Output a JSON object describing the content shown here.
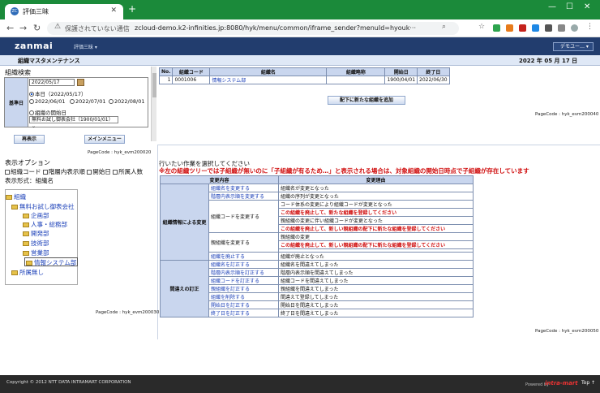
{
  "browser": {
    "tab_title": "評価三昧",
    "favicon_text": "ZC",
    "url_warning": "保護されていない通信",
    "url": "zcloud-demo.k2-infinities.jp:8080/hyk/menu/common/iframe_sender?menuId=hyouk···"
  },
  "app": {
    "logo": "zanmai",
    "menu_label": "評価三昧 ▾",
    "user_menu": "デモユー… ▾"
  },
  "page": {
    "title": "組織マスタメンテナンス",
    "date": "2022 年 05 月 17 日"
  },
  "search": {
    "title": "組織検索",
    "base_date_label": "基準日",
    "date_value": "2022/05/17",
    "radio_today": "本日（2022/05/17）",
    "radio_d1": "2022/06/01",
    "radio_d2": "2022/07/01",
    "radio_d3": "2022/08/01",
    "radio_start": "組織の開始日",
    "company_value": "無料お試し御表会社（1900/01/01） ⌄",
    "btn_search": "再表示",
    "btn_menu": "メインメニュー",
    "page_code": "PageCode : hyk_evm200020"
  },
  "result": {
    "headers": [
      "No.",
      "組織コード",
      "組織名",
      "組織略称",
      "開始日",
      "終了日"
    ],
    "rows": [
      {
        "no": "1",
        "code": "0001006",
        "name": "情報システム部",
        "abbr": "",
        "start": "1900/04/01",
        "end": "2022/06/30"
      }
    ],
    "add_button": "配下に新たな組織を追加",
    "page_code": "PageCode : hyk_evm200040"
  },
  "options": {
    "title": "表示オプション",
    "cb1": "組織コード",
    "cb2": "階層内表示順",
    "cb3": "開始日",
    "cb4": "所属人数",
    "form_label": "表示形式：組織名"
  },
  "tree": {
    "root": "組織",
    "n1": "無料お試し御表会社",
    "n2": "企画部",
    "n3": "人事・総務部",
    "n4": "開発部",
    "n5": "技術部",
    "n6": "営業部",
    "n7": "情報システム部",
    "n8": "所属無し",
    "page_code": "PageCode : hyk_evm200030"
  },
  "ops": {
    "instruction": "行いたい作業を選択してください",
    "warning": "※左の組織ツリーでは子組織が無いのに「子組織が有るため…」と表示される場合は、対象組織の開始日時点で子組織が存在しています",
    "h1": "変更内容",
    "h2": "変更理由",
    "g1": "組織情報による変更",
    "g2": "間違えの訂正",
    "a1": "組織名を変更する",
    "r1": "組織名が変更となった",
    "a2": "階層内表示順を変更する",
    "r2": "組織の序列が変更となった",
    "a3": "組織コードを変更する",
    "r3a": "コード体系の変更により組織コードが変更となった",
    "r3b": "この組織を廃止して、新たな組織を登録してください",
    "r3c": "親組織の変更に伴い組織コードが変更となった",
    "r3d": "この組織を廃止して、新しい親組織の配下に新たな組織を登録してください",
    "a4": "親組織を変更する",
    "r4a": "親組織の変更",
    "r4b": "この組織を廃止して、新しい親組織の配下に新たな組織を登録してください",
    "a5": "組織を廃止する",
    "r5": "組織が廃止となった",
    "b1": "組織名を訂正する",
    "s1": "組織名を間違えてしまった",
    "b2": "階層内表示順を訂正する",
    "s2": "階層内表示順を間違えてしまった",
    "b3": "組織コードを訂正する",
    "s3": "組織コードを間違えてしまった",
    "b4": "親組織を訂正する",
    "s4": "親組織を間違えてしまった",
    "b5": "組織を削除する",
    "s5": "間違えて登録してしまった",
    "b6": "開始日を訂正する",
    "s6": "開始日を間違えてしまった",
    "b7": "終了日を訂正する",
    "s7": "終了日を間違えてしまった",
    "page_code": "PageCode : hyk_evm200050"
  },
  "footer": {
    "copyright": "Copyright © 2012 NTT DATA INTRAMART CORPORATION",
    "powered": "Powered by",
    "brand": "intra-mart",
    "top": "Top ↑"
  }
}
